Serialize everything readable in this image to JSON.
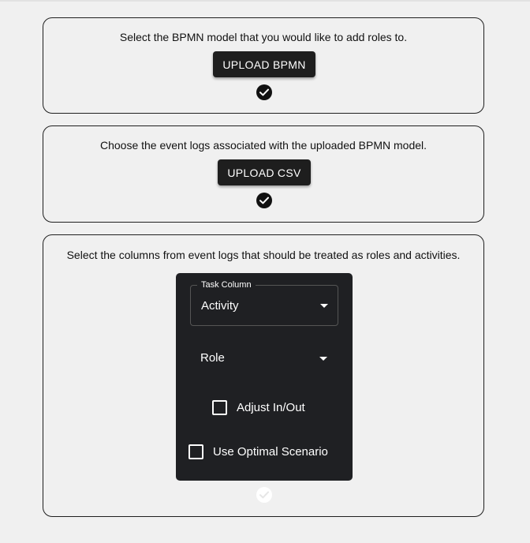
{
  "step1": {
    "instruction": "Select the BPMN model that you would like to add roles to.",
    "button_label": "UPLOAD BPMN",
    "status_icon": "check-circle-icon",
    "completed": true
  },
  "step2": {
    "instruction": "Choose the event logs associated with the uploaded BPMN model.",
    "button_label": "UPLOAD CSV",
    "status_icon": "check-circle-icon",
    "completed": true
  },
  "step3": {
    "instruction": "Select the columns from event logs that should be treated as roles and activities.",
    "task_column": {
      "label": "Task Column",
      "value": "Activity"
    },
    "role_column": {
      "value": "Role"
    },
    "adjust_checkbox": {
      "label": "Adjust In/Out",
      "checked": false
    },
    "optimal_checkbox": {
      "label": "Use Optimal Scenario",
      "checked": false
    },
    "status_icon": "check-circle-icon",
    "completed": false
  },
  "colors": {
    "background": "#f0f0f0",
    "card_border": "#1f1f1f",
    "button_bg": "#1e1e1e",
    "panel_bg": "#1f2023",
    "text_light": "#ffffff"
  }
}
